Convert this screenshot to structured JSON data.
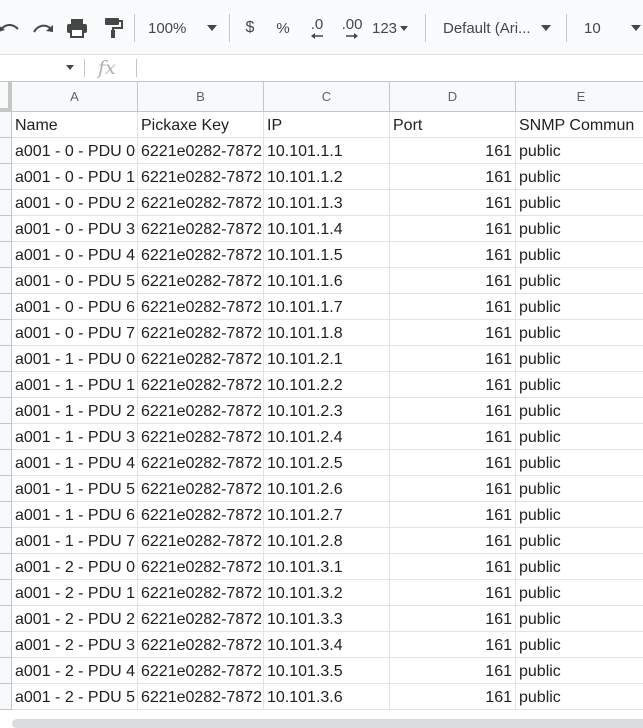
{
  "toolbar": {
    "zoom": "100%",
    "currency": "$",
    "percent": "%",
    "dec_decrease": ".0",
    "dec_increase": ".00",
    "more_formats": "123",
    "font_family": "Default (Ari...",
    "font_size": "10"
  },
  "formula_bar": {
    "fx": "fx"
  },
  "columns": [
    "A",
    "B",
    "C",
    "D",
    "E"
  ],
  "header_row": [
    "Name",
    "Pickaxe Key",
    "IP",
    "Port",
    "SNMP Commun"
  ],
  "rows": [
    [
      "a001 - 0 - PDU 0",
      "6221e0282-7872",
      "10.101.1.1",
      "161",
      "public"
    ],
    [
      "a001 - 0 - PDU 1",
      "6221e0282-7872",
      "10.101.1.2",
      "161",
      "public"
    ],
    [
      "a001 - 0 - PDU 2",
      "6221e0282-7872",
      "10.101.1.3",
      "161",
      "public"
    ],
    [
      "a001 - 0 - PDU 3",
      "6221e0282-7872",
      "10.101.1.4",
      "161",
      "public"
    ],
    [
      "a001 - 0 - PDU 4",
      "6221e0282-7872",
      "10.101.1.5",
      "161",
      "public"
    ],
    [
      "a001 - 0 - PDU 5",
      "6221e0282-7872",
      "10.101.1.6",
      "161",
      "public"
    ],
    [
      "a001 - 0 - PDU 6",
      "6221e0282-7872",
      "10.101.1.7",
      "161",
      "public"
    ],
    [
      "a001 - 0 - PDU 7",
      "6221e0282-7872",
      "10.101.1.8",
      "161",
      "public"
    ],
    [
      "a001 - 1 - PDU 0",
      "6221e0282-7872",
      "10.101.2.1",
      "161",
      "public"
    ],
    [
      "a001 - 1 - PDU 1",
      "6221e0282-7872",
      "10.101.2.2",
      "161",
      "public"
    ],
    [
      "a001 - 1 - PDU 2",
      "6221e0282-7872",
      "10.101.2.3",
      "161",
      "public"
    ],
    [
      "a001 - 1 - PDU 3",
      "6221e0282-7872",
      "10.101.2.4",
      "161",
      "public"
    ],
    [
      "a001 - 1 - PDU 4",
      "6221e0282-7872",
      "10.101.2.5",
      "161",
      "public"
    ],
    [
      "a001 - 1 - PDU 5",
      "6221e0282-7872",
      "10.101.2.6",
      "161",
      "public"
    ],
    [
      "a001 - 1 - PDU 6",
      "6221e0282-7872",
      "10.101.2.7",
      "161",
      "public"
    ],
    [
      "a001 - 1 - PDU 7",
      "6221e0282-7872",
      "10.101.2.8",
      "161",
      "public"
    ],
    [
      "a001 - 2 - PDU 0",
      "6221e0282-7872",
      "10.101.3.1",
      "161",
      "public"
    ],
    [
      "a001 - 2 - PDU 1",
      "6221e0282-7872",
      "10.101.3.2",
      "161",
      "public"
    ],
    [
      "a001 - 2 - PDU 2",
      "6221e0282-7872",
      "10.101.3.3",
      "161",
      "public"
    ],
    [
      "a001 - 2 - PDU 3",
      "6221e0282-7872",
      "10.101.3.4",
      "161",
      "public"
    ],
    [
      "a001 - 2 - PDU 4",
      "6221e0282-7872",
      "10.101.3.5",
      "161",
      "public"
    ],
    [
      "a001 - 2 - PDU 5",
      "6221e0282-7872",
      "10.101.3.6",
      "161",
      "public"
    ]
  ]
}
